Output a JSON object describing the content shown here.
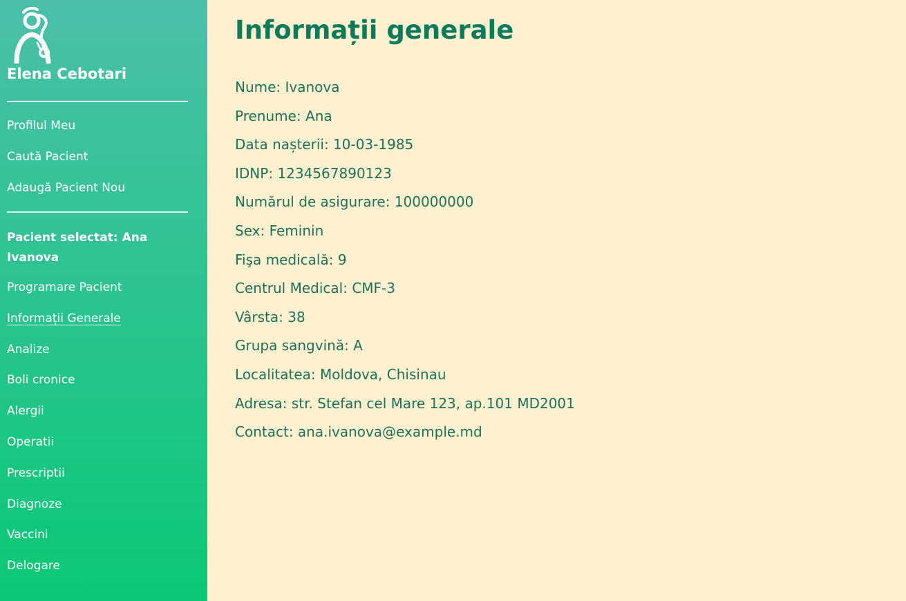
{
  "sidebar": {
    "logo_icon": "doctor-stethoscope-icon",
    "doctor_name": "Elena Cebotari",
    "top_nav": [
      {
        "label": "Profilul Meu"
      },
      {
        "label": "Caută Pacient"
      },
      {
        "label": "Adaugă Pacient Nou"
      }
    ],
    "selected_patient": "Pacient selectat: Ana Ivanova",
    "patient_nav": [
      {
        "label": "Programare Pacient"
      },
      {
        "label": "Informații Generale",
        "active": true
      },
      {
        "label": "Analize"
      },
      {
        "label": "Boli cronice"
      },
      {
        "label": "Alergii"
      },
      {
        "label": "Operatii"
      },
      {
        "label": "Prescriptii"
      },
      {
        "label": "Diagnoze"
      },
      {
        "label": "Vaccini"
      },
      {
        "label": "Delogare"
      }
    ]
  },
  "main": {
    "title": "Informații generale",
    "fields": [
      {
        "text": "Nume: Ivanova"
      },
      {
        "text": "Prenume: Ana"
      },
      {
        "text": "Data nașterii: 10-03-1985"
      },
      {
        "text": "IDNP: 1234567890123"
      },
      {
        "text": "Numărul de asigurare: 100000000"
      },
      {
        "text": "Sex: Feminin"
      },
      {
        "text": "Fişa medicală: 9"
      },
      {
        "text": "Centrul Medical: CMF-3"
      },
      {
        "text": "Vârsta: 38"
      },
      {
        "text": "Grupa sangvină: A"
      },
      {
        "text": "Localitatea: Moldova, Chisinau"
      },
      {
        "text": "Adresa: str. Stefan cel Mare 123, ap.101 MD2001"
      },
      {
        "text": "Contact: ana.ivanova@example.md"
      }
    ]
  },
  "colors": {
    "sidebar_top": "#4bbfa9",
    "sidebar_bottom": "#0ac875",
    "main_bg": "#fff1cf",
    "title": "#0e7a5c",
    "text": "#1c7058"
  }
}
